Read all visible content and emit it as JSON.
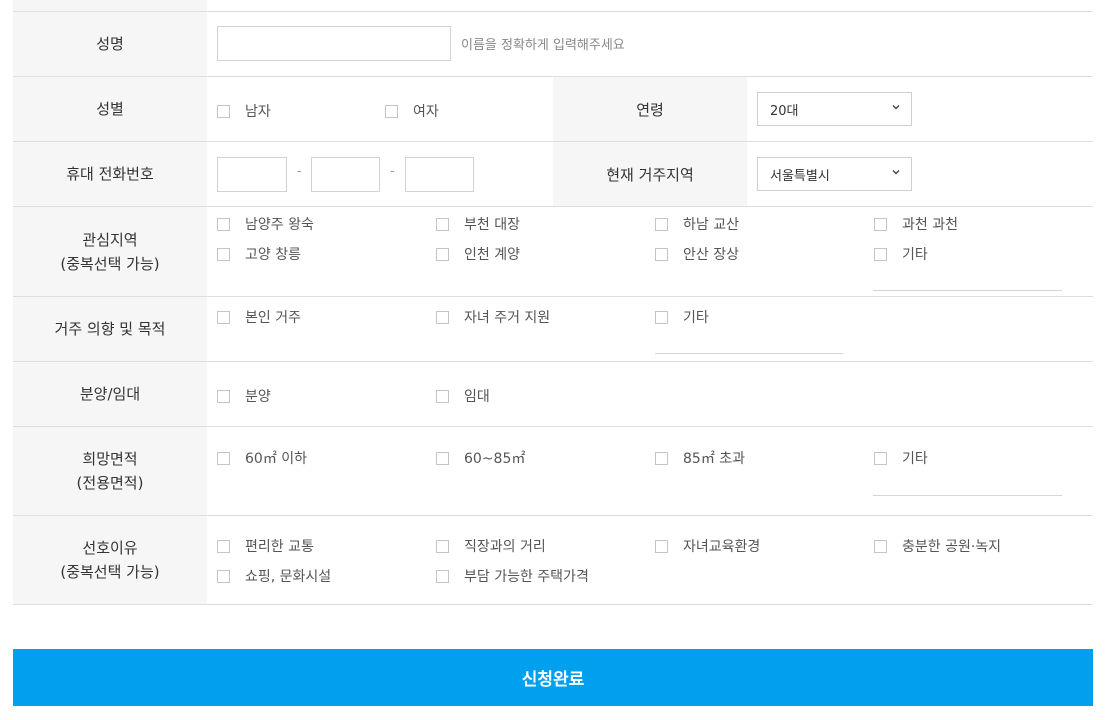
{
  "name": {
    "label": "성명",
    "value": "",
    "hint": "이름을 정확하게 입력해주세요"
  },
  "gender": {
    "label": "성별",
    "options": [
      "남자",
      "여자"
    ]
  },
  "age": {
    "label": "연령",
    "selected": "20대"
  },
  "phone": {
    "label": "휴대 전화번호",
    "sep": "-",
    "parts": [
      "",
      "",
      ""
    ]
  },
  "residence": {
    "label": "현재 거주지역",
    "selected": "서울특별시"
  },
  "interest_region": {
    "label_line1": "관심지역",
    "label_line2": "(중복선택 가능)",
    "options": [
      "남양주 왕숙",
      "부천 대장",
      "하남 교산",
      "과천 과천",
      "고양 창릉",
      "인천 계양",
      "안산 장상",
      "기타"
    ],
    "other_value": ""
  },
  "intent": {
    "label": "거주 의향 및 목적",
    "options": [
      "본인 거주",
      "자녀 주거 지원",
      "기타"
    ],
    "other_value": ""
  },
  "sale_type": {
    "label": "분양/임대",
    "options": [
      "분양",
      "임대"
    ]
  },
  "area": {
    "label_line1": "희망면적",
    "label_line2": "(전용면적)",
    "options": [
      "60㎡ 이하",
      "60~85㎡",
      "85㎡ 초과",
      "기타"
    ],
    "other_value": ""
  },
  "reason": {
    "label_line1": "선호이유",
    "label_line2": "(중복선택 가능)",
    "options": [
      "편리한 교통",
      "직장과의 거리",
      "자녀교육환경",
      "충분한 공원·녹지",
      "쇼핑, 문화시설",
      "부담 가능한 주택가격"
    ]
  },
  "submit_label": "신청완료",
  "colors": {
    "accent": "#00a0ee",
    "label_bg": "#f6f6f6"
  }
}
